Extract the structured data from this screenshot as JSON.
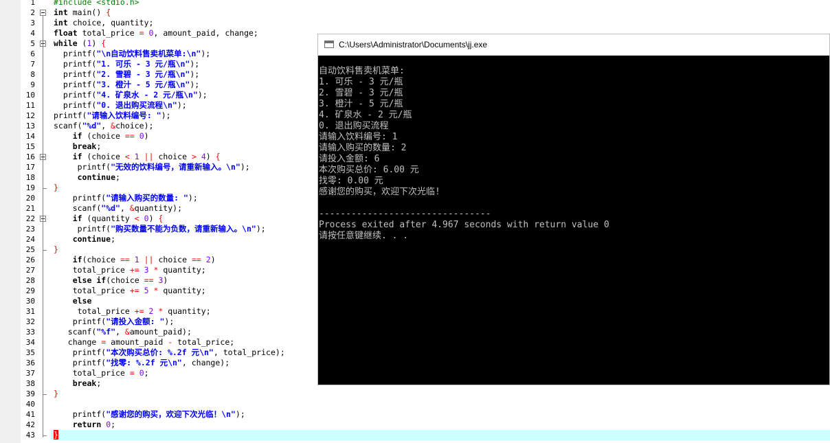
{
  "console": {
    "title": "C:\\Users\\Administrator\\Documents\\jj.exe",
    "lines": [
      "自动饮料售卖机菜单:",
      "1. 可乐 - 3 元/瓶",
      "2. 雪碧 - 3 元/瓶",
      "3. 橙汁 - 5 元/瓶",
      "4. 矿泉水 - 2 元/瓶",
      "0. 退出购买流程",
      "请输入饮料编号: 1",
      "请输入购买的数量: 2",
      "请投入金额: 6",
      "本次购买总价: 6.00 元",
      "找零: 0.00 元",
      "感谢您的购买，欢迎下次光临!",
      "",
      "--------------------------------",
      "Process exited after 4.967 seconds with return value 0",
      "请按任意键继续. . ."
    ]
  },
  "editor": {
    "line_numbers": [
      "1",
      "2",
      "3",
      "4",
      "5",
      "6",
      "7",
      "8",
      "9",
      "10",
      "11",
      "12",
      "13",
      "14",
      "15",
      "16",
      "17",
      "18",
      "19",
      "20",
      "21",
      "22",
      "23",
      "24",
      "25",
      "26",
      "27",
      "28",
      "29",
      "30",
      "31",
      "32",
      "33",
      "34",
      "35",
      "36",
      "37",
      "38",
      "39",
      "40",
      "41",
      "42",
      "43"
    ],
    "current_line": "43",
    "code_lines": [
      "#include <stdio.h>",
      "int main() {",
      "int choice, quantity;",
      "float total_price = 0, amount_paid, change;",
      "while (1) {",
      "  printf(\"\\n自动饮料售卖机菜单:\\n\");",
      "  printf(\"1. 可乐 - 3 元/瓶\\n\");",
      "  printf(\"2. 雪碧 - 3 元/瓶\\n\");",
      "  printf(\"3. 橙汁 - 5 元/瓶\\n\");",
      "  printf(\"4. 矿泉水 - 2 元/瓶\\n\");",
      "  printf(\"0. 退出购买流程\\n\");",
      "printf(\"请输入饮料编号: \");",
      "scanf(\"%d\", &choice);",
      "    if (choice == 0)",
      "    break;",
      "    if (choice < 1 || choice > 4) {",
      "     printf(\"无效的饮料编号，请重新输入。\\n\");",
      "     continue;",
      "}",
      "    printf(\"请输入购买的数量: \");",
      "    scanf(\"%d\", &quantity);",
      "    if (quantity < 0) {",
      "     printf(\"购买数量不能为负数，请重新输入。\\n\");",
      "    continue;",
      "}",
      "    if(choice == 1 || choice == 2)",
      "    total_price += 3 * quantity;",
      "    else if(choice == 3)",
      "    total_price += 5 * quantity;",
      "    else",
      "     total_price += 2 * quantity;",
      "    printf(\"请投入金额: \");",
      "   scanf(\"%f\", &amount_paid);",
      "   change = amount_paid - total_price;",
      "    printf(\"本次购买总价: %.2f 元\\n\", total_price);",
      "    printf(\"找零: %.2f 元\\n\", change);",
      "    total_price = 0;",
      "    break;",
      "}",
      "",
      "    printf(\"感谢您的购买，欢迎下次光临！\\n\");",
      "    return 0;",
      "}"
    ]
  },
  "colors": {
    "keyword": "#000000",
    "string": "#0000ff",
    "number": "#8000ff",
    "operator": "#ff0000",
    "preprocessor": "#008000",
    "current_line_bg": "#ccffff",
    "console_bg": "#000000",
    "console_text": "#c0c0c0"
  }
}
